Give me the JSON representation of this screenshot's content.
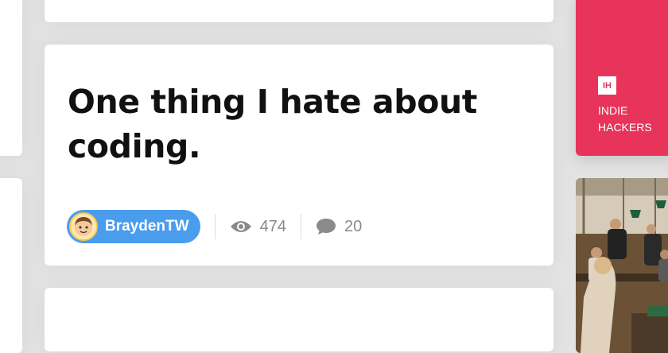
{
  "post": {
    "title": "One thing I hate about coding.",
    "author": "BraydenTW",
    "views": "474",
    "comments": "20"
  },
  "sidebar": {
    "logo_text": "IH",
    "brand_name": "INDIE HACKERS"
  },
  "colors": {
    "background": "#e3e3e3",
    "author_pill": "#4a9ced",
    "brand": "#e8345a",
    "muted": "#8a8a8a"
  },
  "icons": [
    "avatar",
    "eye-icon",
    "comment-icon",
    "ih-logo"
  ]
}
